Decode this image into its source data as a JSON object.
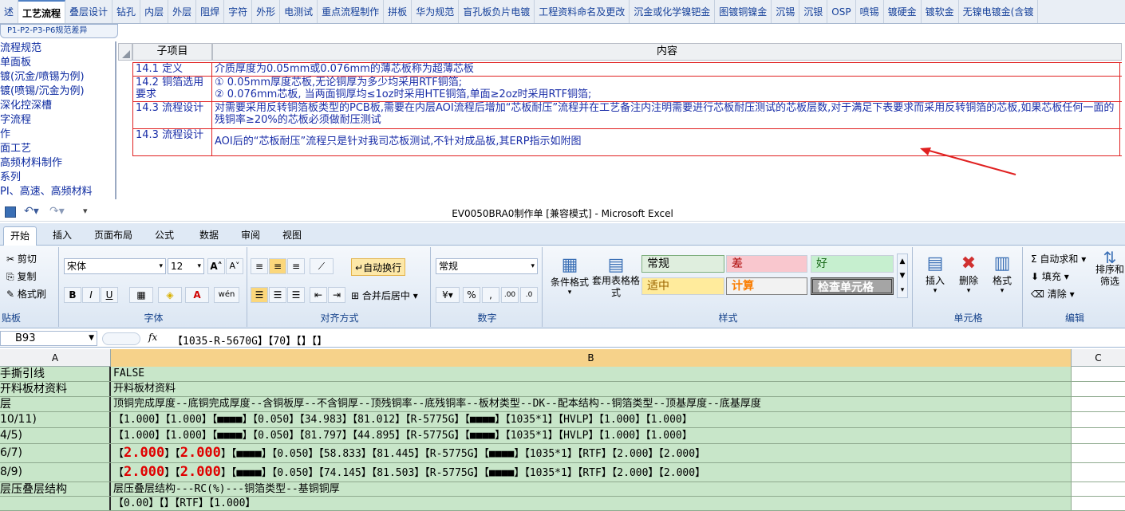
{
  "top_tabs": [
    "述",
    "工艺流程",
    "叠层设计",
    "钻孔",
    "内层",
    "外层",
    "阻焊",
    "字符",
    "外形",
    "电测试",
    "重点流程制作",
    "拼板",
    "华为规范",
    "盲孔板负片电镀",
    "工程资料命名及更改",
    "沉金或化学镍钯金",
    "图镀铜镍金",
    "沉锡",
    "沉银",
    "OSP",
    "喷锡",
    "镀硬金",
    "镀软金",
    "无镍电镀金(含镀"
  ],
  "active_top_tab": "工艺流程",
  "sub_tab": "P1-P2-P3-P6规范差异",
  "left_list": [
    "流程规范",
    "单面板",
    "镀(沉金/喷锡为例)",
    "镀(喷锡/沉金为例)",
    "深化控深槽",
    "字流程",
    "作",
    "面工艺",
    "高频材料制作",
    "系列",
    "PI、高速、高频材料"
  ],
  "sheet": {
    "headers": [
      "子项目",
      "内容"
    ],
    "rows": [
      {
        "item": "14.1 定义",
        "content": "介质厚度为0.05mm或0.076mm的薄芯板称为超薄芯板"
      },
      {
        "item": "14.2 铜箔选用要求",
        "content": "① 0.05mm厚度芯板,无论铜厚为多少均采用RTF铜箔;\n② 0.076mm芯板, 当两面铜厚均≤1oz时采用HTE铜箔,单面≥2oz时采用RTF铜箔;"
      },
      {
        "item": "14.3 流程设计",
        "content": "对需要采用反转铜箔板类型的PCB板,需要在内层AOI流程后增加“芯板耐压”流程并在工艺备注内注明需要进行芯板耐压测试的芯板层数,对于满足下表要求而采用反转铜箔的芯板,如果芯板任何一面的残铜率≥20%的芯板必须做耐压测试"
      },
      {
        "item": "14.3 流程设计",
        "content": "AOI后的“芯板耐压”流程只是针对我司芯板测试,不针对成品板,其ERP指示如附图"
      }
    ]
  },
  "excel": {
    "title": "EV0050BRA0制作单 [兼容模式] - Microsoft Excel",
    "ribbon_tabs": [
      "开始",
      "插入",
      "页面布局",
      "公式",
      "数据",
      "审阅",
      "视图"
    ],
    "clipboard": {
      "cut": "剪切",
      "copy": "复制",
      "painter": "格式刷",
      "label": "贴板"
    },
    "font": {
      "name": "宋体",
      "size": "12",
      "label": "字体"
    },
    "alignment": {
      "wrap": "自动换行",
      "merge": "合并后居中",
      "label": "对齐方式"
    },
    "number": {
      "format": "常规",
      "label": "数字"
    },
    "styles": {
      "cond": "条件格式",
      "table": "套用表格格式",
      "normal": "常规",
      "bad": "差",
      "good": "好",
      "neutral": "适中",
      "calc": "计算",
      "check": "检查单元格",
      "label": "样式"
    },
    "cells": {
      "insert": "插入",
      "delete": "删除",
      "format": "格式",
      "label": "单元格"
    },
    "editing": {
      "autosum": "自动求和",
      "fill": "填充",
      "clear": "清除",
      "sort": "排序和筛选",
      "label": "编辑"
    },
    "name_box": "B93",
    "formula": "【1035-R-5670G】【70】【】【】",
    "col_headers": [
      "A",
      "B",
      "C"
    ],
    "rows": [
      {
        "a": "手撕引线",
        "b": "FALSE"
      },
      {
        "a": "开料板材资料",
        "b": "开料板材资料"
      },
      {
        "a": "层",
        "b": "顶铜完成厚度--底铜完成厚度--含铜板厚--不含铜厚--顶残铜率--底残铜率--板材类型--DK--配本结构--铜箔类型--顶基厚度--底基厚度"
      },
      {
        "a": "10/11)",
        "b": "【1.000】【1.000】【■■■■】【0.050】【34.983】【81.012】【R-5775G】【■■■■】【1035*1】【HVLP】【1.000】【1.000】"
      },
      {
        "a": "4/5)",
        "b": "【1.000】【1.000】【■■■■】【0.050】【81.797】【44.895】【R-5775G】【■■■■】【1035*1】【HVLP】【1.000】【1.000】"
      },
      {
        "a": "6/7)",
        "b1": "【",
        "r1": "2.000",
        "b2": "】【",
        "r2": "2.000",
        "b3": "】【■■■■】【0.050】【58.833】【81.445】【R-5775G】【■■■■】【1035*1】【RTF】【2.000】【2.000】"
      },
      {
        "a": "8/9)",
        "b1": "【",
        "r1": "2.000",
        "b2": "】【",
        "r2": "2.000",
        "b3": "】【■■■■】【0.050】【74.145】【81.503】【R-5775G】【■■■■】【1035*1】【RTF】【2.000】【2.000】"
      },
      {
        "a": "层压叠层结构",
        "b": "层压叠层结构---RC(%)---铜箔类型--基铜铜厚"
      },
      {
        "a": "",
        "b": "【0.00】【】【RTF】【1.000】"
      }
    ]
  },
  "colors": {
    "accent": "#e02020",
    "cell_green": "#c8e6c9"
  }
}
